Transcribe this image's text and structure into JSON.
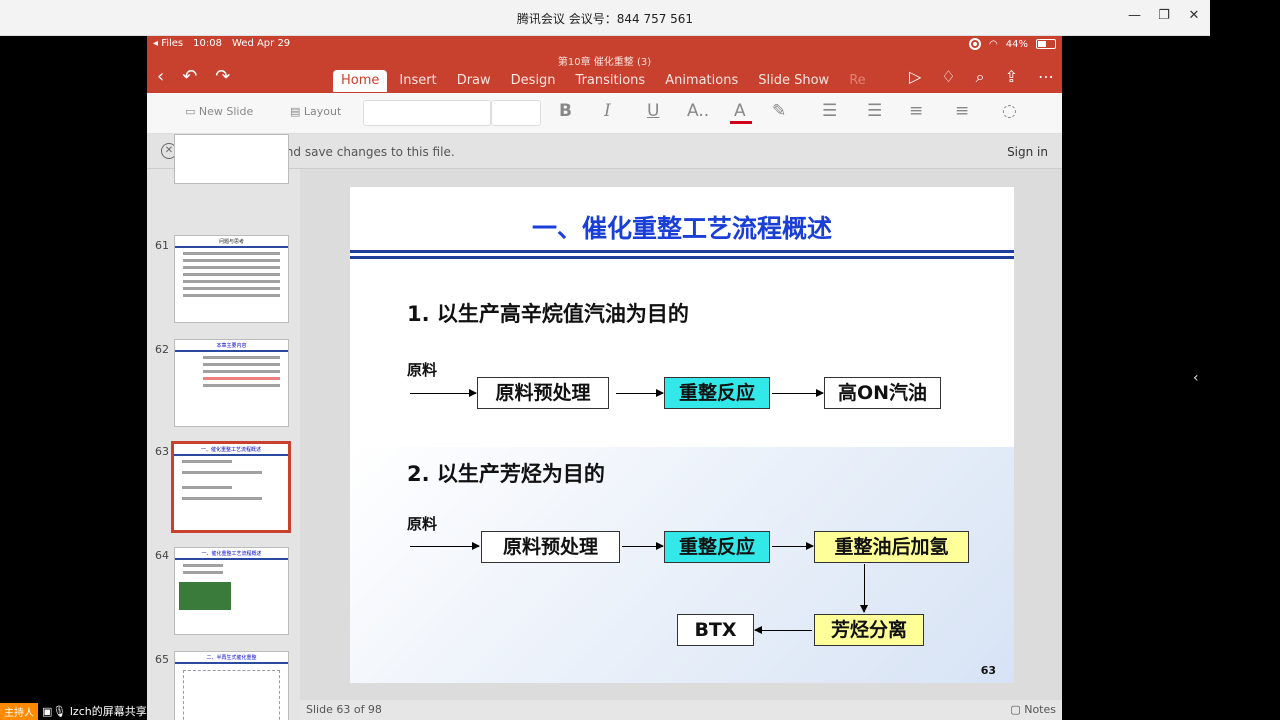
{
  "window": {
    "title": "腾讯会议 会议号：844 757 561",
    "controls": [
      "minimize",
      "restore",
      "close"
    ]
  },
  "status": {
    "back_app": "◂ Files",
    "time": "10:08",
    "date": "Wed Apr 29",
    "battery": "44%"
  },
  "document": {
    "title": "第10章 催化重整 (3)"
  },
  "ribbon": {
    "tabs": [
      "Home",
      "Insert",
      "Draw",
      "Design",
      "Transitions",
      "Animations",
      "Slide Show",
      "Re"
    ],
    "active_tab": "Home"
  },
  "toolbar": {
    "new_slide": "New Slide",
    "layout": "Layout",
    "bold": "B",
    "italic": "I",
    "underline": "U",
    "font_size": "A..",
    "font_color": "A",
    "font_color_hex": "#d0021b"
  },
  "signin_bar": {
    "message": "Sign in to edit and save changes to this file.",
    "link": "Sign in"
  },
  "thumbnails": [
    {
      "number": "61",
      "title": "问题与思考"
    },
    {
      "number": "62",
      "title": "本章主要内容"
    },
    {
      "number": "63",
      "title": "一、催化重整工艺流程概述",
      "selected": true
    },
    {
      "number": "64",
      "title": "一、催化重整工艺流程概述"
    },
    {
      "number": "65",
      "title": "二、半再生式催化重整"
    }
  ],
  "slide": {
    "title": "一、催化重整工艺流程概述",
    "section1": "1. 以生产高辛烷值汽油为目的",
    "section2": "2. 以生产芳烃为目的",
    "raw_label": "原料",
    "flow1": [
      "原料预处理",
      "重整反应",
      "高ON汽油"
    ],
    "flow2": [
      "原料预处理",
      "重整反应",
      "重整油后加氢",
      "芳烃分离",
      "BTX"
    ],
    "page_number": "63",
    "title_color": "#1a3fd6",
    "box_colors": {
      "cyan": "#33e8e8",
      "yellow": "#ffff99"
    }
  },
  "footer": {
    "slide_count": "Slide 63 of 98",
    "notes": "Notes"
  },
  "host": {
    "role": "主持人",
    "name": "lzch的屏幕共享"
  }
}
